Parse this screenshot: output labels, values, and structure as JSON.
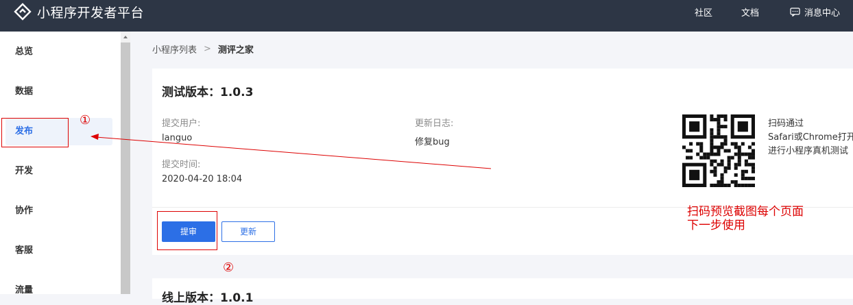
{
  "header": {
    "brand": "小程序开发者平台",
    "nav": {
      "community": "社区",
      "docs": "文档",
      "messages": "消息中心"
    }
  },
  "sidebar": {
    "items": [
      {
        "label": "总览"
      },
      {
        "label": "数据"
      },
      {
        "label": "发布",
        "active": true
      },
      {
        "label": "开发"
      },
      {
        "label": "协作"
      },
      {
        "label": "客服"
      },
      {
        "label": "流量"
      }
    ]
  },
  "breadcrumb": {
    "parent": "小程序列表",
    "separator": ">",
    "current": "测评之家"
  },
  "test_version": {
    "title": "测试版本：1.0.3",
    "submit_user_label": "提交用户:",
    "submit_user": "languo",
    "changelog_label": "更新日志:",
    "changelog": "修复bug",
    "submit_time_label": "提交时间:",
    "submit_time": "2020-04-20 18:04",
    "actions": {
      "review": "提审",
      "update": "更新"
    },
    "qr_text": [
      "扫码通过",
      "Safari或Chrome打开",
      "进行小程序真机测试"
    ]
  },
  "online_version": {
    "title": "线上版本：1.0.1"
  },
  "annotations": {
    "marker_1": "①",
    "marker_2": "②",
    "note_line1": "扫码预览截图每个页面",
    "note_line2": "下一步使用",
    "color": "#dd0000"
  },
  "colors": {
    "topbar": "#2d3645",
    "primary": "#2c6fe6",
    "active_bg": "#eef3fb"
  }
}
